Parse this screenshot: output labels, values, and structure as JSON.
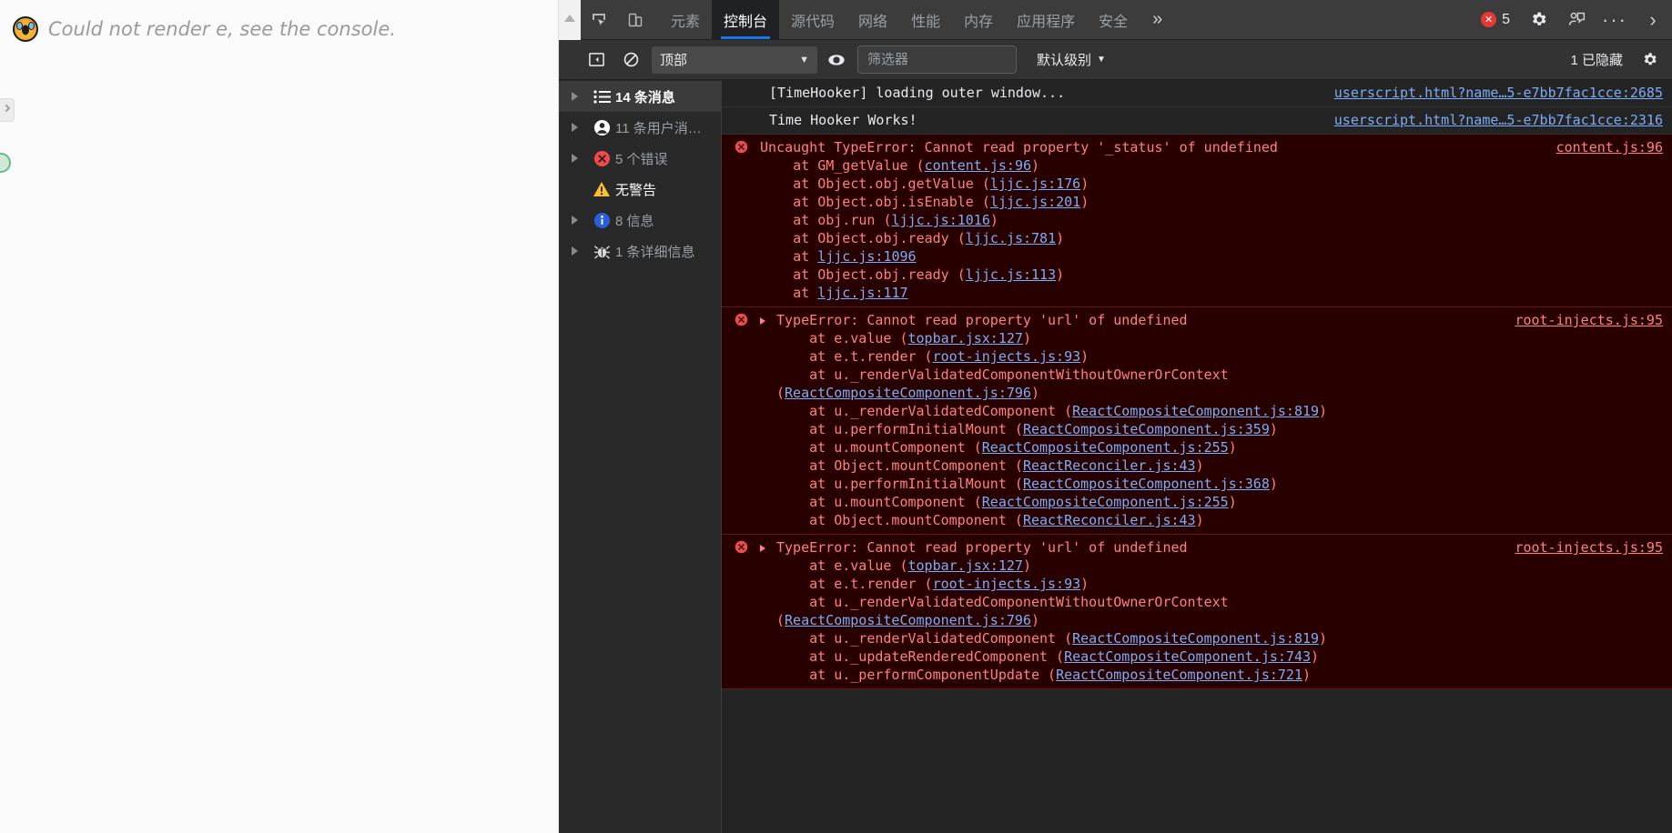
{
  "page": {
    "emoji": "scream-face-emoji",
    "message": "Could not render e, see the console."
  },
  "devtools": {
    "tabs": [
      {
        "label": "元素",
        "active": false
      },
      {
        "label": "控制台",
        "active": true
      },
      {
        "label": "源代码",
        "active": false
      },
      {
        "label": "网络",
        "active": false
      },
      {
        "label": "性能",
        "active": false
      },
      {
        "label": "内存",
        "active": false
      },
      {
        "label": "应用程序",
        "active": false
      },
      {
        "label": "安全",
        "active": false
      }
    ],
    "more_tabs_label": "»",
    "error_count": "5",
    "overflow_label": "···",
    "expand_label": "›"
  },
  "console_toolbar": {
    "context_value": "顶部",
    "context_arrow": "▼",
    "filter_placeholder": "筛选器",
    "filter_value": "",
    "level_label": "默认级别",
    "level_arrow": "▼",
    "hidden_label": "1 已隐藏"
  },
  "sidebar": {
    "items": [
      {
        "label": "14 条消息",
        "icon": "list-icon",
        "selected": true,
        "expandable": true,
        "bright": true
      },
      {
        "label": "11 条用户消…",
        "icon": "person-icon",
        "selected": false,
        "expandable": true,
        "bright": false
      },
      {
        "label": "5 个错误",
        "icon": "error-icon",
        "selected": false,
        "expandable": true,
        "bright": false
      },
      {
        "label": "无警告",
        "icon": "warning-icon",
        "selected": false,
        "expandable": false,
        "bright": true
      },
      {
        "label": "8 信息",
        "icon": "info-icon",
        "selected": false,
        "expandable": true,
        "bright": false
      },
      {
        "label": "1 条详细信息",
        "icon": "bug-icon",
        "selected": false,
        "expandable": true,
        "bright": false
      }
    ]
  },
  "messages": [
    {
      "level": "info",
      "text": "[TimeHooker] loading outer window...",
      "source": "userscript.html?name…5-e7bb7fac1cce:2685"
    },
    {
      "level": "info",
      "text": "Time Hooker Works!",
      "source": "userscript.html?name…5-e7bb7fac1cce:2316"
    },
    {
      "level": "error",
      "expandable": false,
      "text": "Uncaught TypeError: Cannot read property '_status' of undefined",
      "source": "content.js:96",
      "stack": [
        {
          "fn": "    at GM_getValue (",
          "link": "content.js:96",
          "end": ")"
        },
        {
          "fn": "    at Object.obj.getValue (",
          "link": "ljjc.js:176",
          "end": ")"
        },
        {
          "fn": "    at Object.obj.isEnable (",
          "link": "ljjc.js:201",
          "end": ")"
        },
        {
          "fn": "    at obj.run (",
          "link": "ljjc.js:1016",
          "end": ")"
        },
        {
          "fn": "    at Object.obj.ready (",
          "link": "ljjc.js:781",
          "end": ")"
        },
        {
          "fn": "    at ",
          "link": "ljjc.js:1096",
          "end": ""
        },
        {
          "fn": "    at Object.obj.ready (",
          "link": "ljjc.js:113",
          "end": ")"
        },
        {
          "fn": "    at ",
          "link": "ljjc.js:117",
          "end": ""
        }
      ]
    },
    {
      "level": "error",
      "expandable": true,
      "text": "TypeError: Cannot read property 'url' of undefined",
      "source": "root-injects.js:95",
      "stack": [
        {
          "fn": "    at e.value (",
          "link": "topbar.jsx:127",
          "end": ")"
        },
        {
          "fn": "    at e.t.render (",
          "link": "root-injects.js:93",
          "end": ")"
        },
        {
          "fn": "    at u._renderValidatedComponentWithoutOwnerOrContext (",
          "link": "ReactCompositeComponent.js:796",
          "end": ")"
        },
        {
          "fn": "    at u._renderValidatedComponent (",
          "link": "ReactCompositeComponent.js:819",
          "end": ")"
        },
        {
          "fn": "    at u.performInitialMount (",
          "link": "ReactCompositeComponent.js:359",
          "end": ")"
        },
        {
          "fn": "    at u.mountComponent (",
          "link": "ReactCompositeComponent.js:255",
          "end": ")"
        },
        {
          "fn": "    at Object.mountComponent (",
          "link": "ReactReconciler.js:43",
          "end": ")"
        },
        {
          "fn": "    at u.performInitialMount (",
          "link": "ReactCompositeComponent.js:368",
          "end": ")"
        },
        {
          "fn": "    at u.mountComponent (",
          "link": "ReactCompositeComponent.js:255",
          "end": ")"
        },
        {
          "fn": "    at Object.mountComponent (",
          "link": "ReactReconciler.js:43",
          "end": ")"
        }
      ]
    },
    {
      "level": "error",
      "expandable": true,
      "text": "TypeError: Cannot read property 'url' of undefined",
      "source": "root-injects.js:95",
      "stack": [
        {
          "fn": "    at e.value (",
          "link": "topbar.jsx:127",
          "end": ")"
        },
        {
          "fn": "    at e.t.render (",
          "link": "root-injects.js:93",
          "end": ")"
        },
        {
          "fn": "    at u._renderValidatedComponentWithoutOwnerOrContext (",
          "link": "ReactCompositeComponent.js:796",
          "end": ")"
        },
        {
          "fn": "    at u._renderValidatedComponent (",
          "link": "ReactCompositeComponent.js:819",
          "end": ")"
        },
        {
          "fn": "    at u._updateRenderedComponent (",
          "link": "ReactCompositeComponent.js:743",
          "end": ")"
        },
        {
          "fn": "    at u._performComponentUpdate (",
          "link": "ReactCompositeComponent.js:721",
          "end": ")"
        }
      ]
    }
  ],
  "colors": {
    "accent": "#1a73e8",
    "error": "#e53935",
    "error_bg": "#290000",
    "error_text": "#ff8080",
    "link": "#7cacf8",
    "warning": "#fbc02d",
    "info": "#1a73e8",
    "panel_bg": "#242424",
    "toolbar_bg": "#3c3c3c"
  }
}
